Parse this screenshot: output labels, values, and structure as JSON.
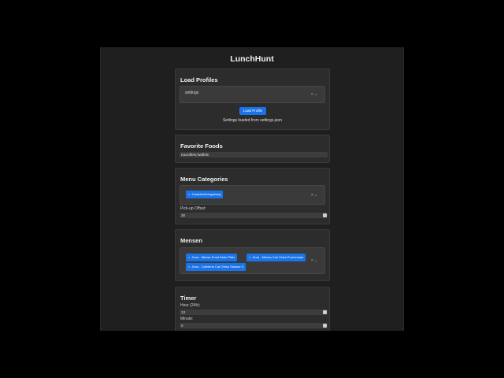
{
  "app": {
    "title": "LunchHunt"
  },
  "load_profiles": {
    "title": "Load Profiles",
    "selected": "settings",
    "button_label": "Load Profile",
    "status": "Settings loaded from settings.json"
  },
  "favorite_foods": {
    "title": "Favorite Foods",
    "value": "Kartoffeln;Waffeln"
  },
  "menu_categories": {
    "title": "Menu Categories",
    "chips": [
      "Zusatzbeilvergabung"
    ],
    "pickup_label": "Pick-up Offset:",
    "pickup_value": "30"
  },
  "mensen": {
    "title": "Mensen",
    "chips": [
      "Jena - Mensa Ernst Abbe Platz",
      "Jena - Mensa Carl Zeiss Promenade",
      "Jena - Cafeteria Carl Zeiss Strasse 3"
    ]
  },
  "timer": {
    "title": "Timer",
    "hour_label": "Hour (24h):",
    "hour_value": "13",
    "minute_label": "Minute:",
    "minute_value": "0"
  },
  "icons": {
    "clear": "x-icon",
    "dropdown": "chevron-down-icon"
  },
  "colors": {
    "accent": "#1a73e8",
    "card": "#2c2c2c",
    "panel": "#1f1f1f"
  }
}
